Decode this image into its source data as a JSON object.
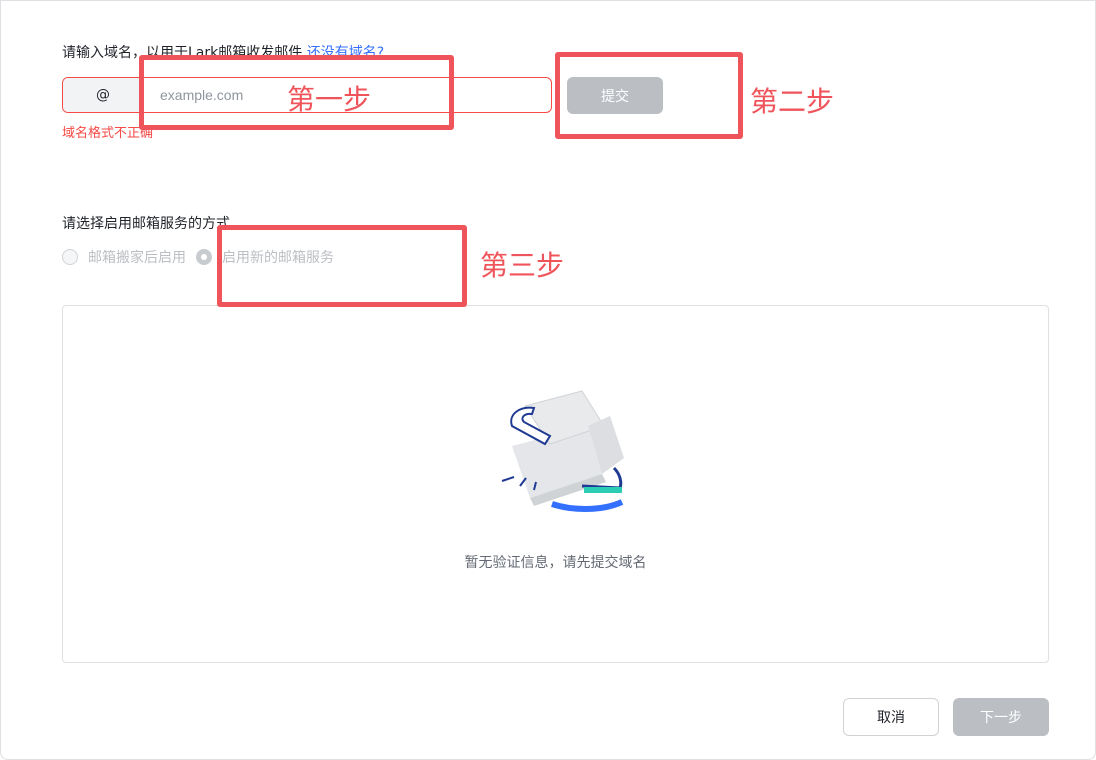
{
  "domain_section": {
    "prompt": "请输入域名，以用于Lark邮箱收发邮件",
    "help_link": "还没有域名?",
    "prefix": "@",
    "placeholder": "example.com",
    "value": "",
    "error": "域名格式不正确",
    "submit_label": "提交"
  },
  "mode_section": {
    "prompt": "请选择启用邮箱服务的方式",
    "options": [
      {
        "label": "邮箱搬家后启用",
        "checked": false
      },
      {
        "label": "启用新的邮箱服务",
        "checked": true
      }
    ]
  },
  "empty_state": {
    "message": "暂无验证信息，请先提交域名",
    "icon": "empty-box-illustration"
  },
  "footer": {
    "cancel_label": "取消",
    "next_label": "下一步"
  },
  "annotations": {
    "step1": "第一步",
    "step2": "第二步",
    "step3": "第三步"
  },
  "colors": {
    "error": "#f54a45",
    "link": "#3370ff",
    "disabled_button": "#bbbfc4",
    "annotation": "#f0545b"
  }
}
